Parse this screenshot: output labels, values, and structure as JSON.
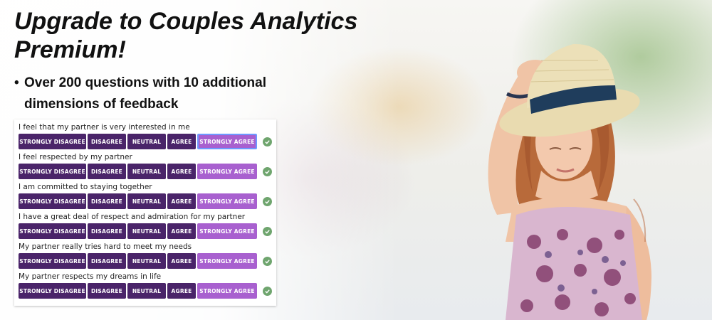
{
  "headline": {
    "line1": "Upgrade to Couples Analytics",
    "line2": "Premium!"
  },
  "bullet": {
    "dot": "•",
    "line1": "Over 200 questions with 10 additional",
    "line2": "dimensions of feedback"
  },
  "survey": {
    "options": [
      "STRONGLY DISAGREE",
      "DISAGREE",
      "NEUTRAL",
      "AGREE",
      "STRONGLY AGREE"
    ],
    "selected_index": 4,
    "colors": {
      "option": "#4a2469",
      "selected": "#a860cf",
      "check": "#6fa56e",
      "focus_ring": "#6f98ff"
    },
    "questions": [
      {
        "text": "I feel that my partner is very interested in me",
        "focused": true
      },
      {
        "text": "I feel respected by my partner",
        "focused": false
      },
      {
        "text": "I am committed to staying together",
        "focused": false
      },
      {
        "text": "I have a great deal of respect and admiration for my partner",
        "focused": false
      },
      {
        "text": "My partner really tries hard to meet my needs",
        "focused": false
      },
      {
        "text": "My partner respects my dreams in life",
        "focused": false
      }
    ]
  },
  "check_icon": "check-circle-icon"
}
